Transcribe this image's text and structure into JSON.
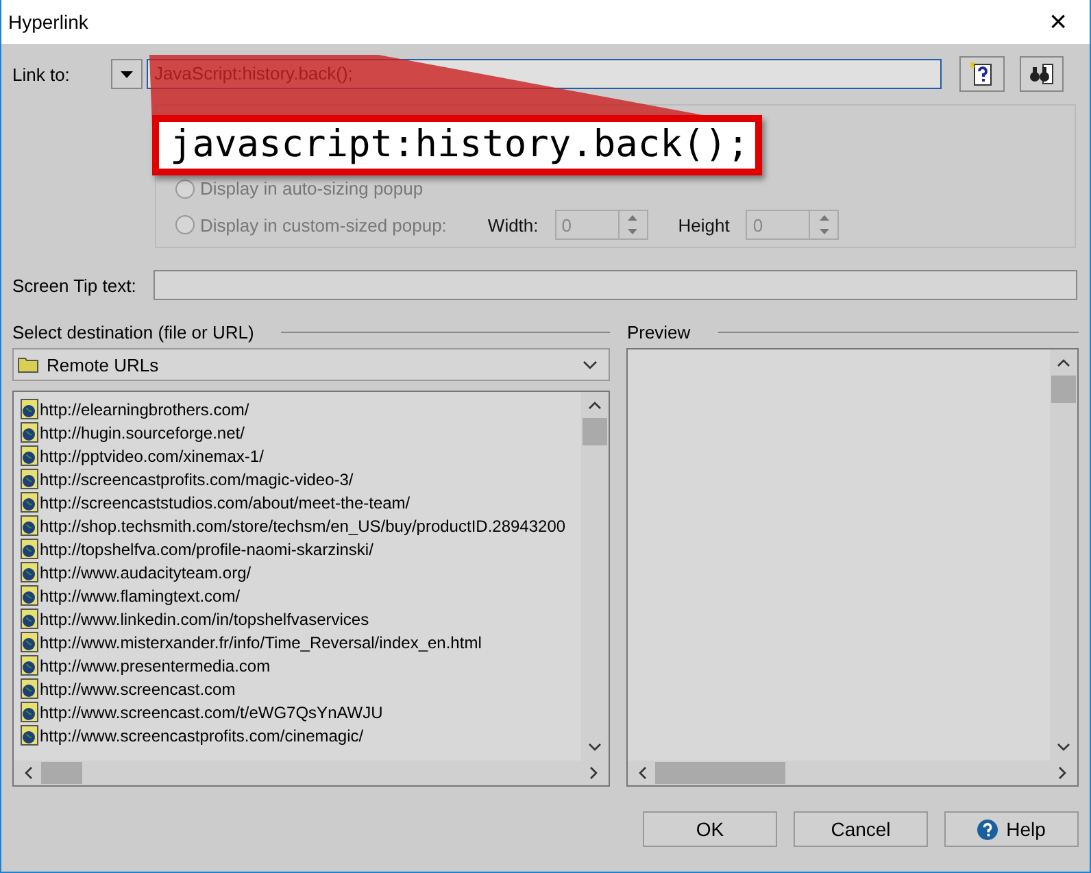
{
  "window": {
    "title": "Hyperlink",
    "close": "×"
  },
  "link_to": {
    "label": "Link to:",
    "value": "JavaScript:history.back();"
  },
  "callout": {
    "text": "javascript:history.back();"
  },
  "hyperlink_options": {
    "disabled": true,
    "radios": [
      {
        "label": "Display in auto-sizing popup",
        "selected": false
      },
      {
        "label": "Display in custom-sized popup:",
        "selected": false
      }
    ],
    "width": {
      "label": "Width:",
      "value": "0"
    },
    "height": {
      "label": "Height",
      "value": "0"
    }
  },
  "screen_tip": {
    "label": "Screen Tip text:"
  },
  "destination": {
    "label": "Select destination (file or URL)",
    "folder": "Remote URLs",
    "urls": [
      "http://elearningbrothers.com/",
      "http://hugin.sourceforge.net/",
      "http://pptvideo.com/xinemax-1/",
      "http://screencastprofits.com/magic-video-3/",
      "http://screencaststudios.com/about/meet-the-team/",
      "http://shop.techsmith.com/store/techsm/en_US/buy/productID.28943200",
      "http://topshelfva.com/profile-naomi-skarzinski/",
      "http://www.audacityteam.org/",
      "http://www.flamingtext.com/",
      "http://www.linkedin.com/in/topshelfvaservices",
      "http://www.misterxander.fr/info/Time_Reversal/index_en.html",
      "http://www.presentermedia.com",
      "http://www.screencast.com",
      "http://www.screencast.com/t/eWG7QsYnAWJU",
      "http://www.screencastprofits.com/cinemagic/"
    ]
  },
  "preview": {
    "label": "Preview"
  },
  "buttons": [
    {
      "label": "OK",
      "kind": "plain"
    },
    {
      "label": "Cancel",
      "kind": "plain"
    },
    {
      "label": "Help",
      "kind": "help"
    }
  ]
}
